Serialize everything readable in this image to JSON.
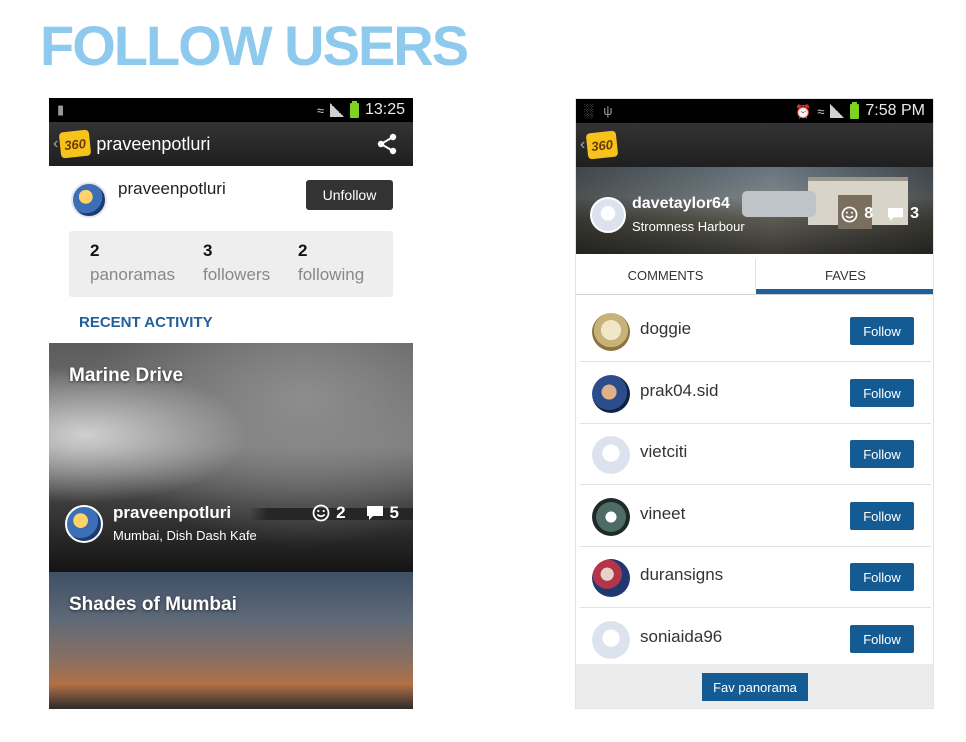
{
  "page_title": "FOLLOW USERS",
  "left_phone": {
    "status_time": "13:25",
    "logo_text": "360",
    "actionbar_title": "praveenpotluri",
    "profile": {
      "name": "praveenpotluri",
      "unfollow_label": "Unfollow"
    },
    "stats": [
      {
        "count": "2",
        "label": "panoramas"
      },
      {
        "count": "3",
        "label": "followers"
      },
      {
        "count": "2",
        "label": "following"
      }
    ],
    "recent_activity_label": "RECENT ACTIVITY",
    "panoramas": [
      {
        "title": "Marine Drive",
        "user": "praveenpotluri",
        "location": "Mumbai, Dish Dash Kafe",
        "faves": "2",
        "comments": "5"
      },
      {
        "title": "Shades of Mumbai"
      }
    ]
  },
  "right_phone": {
    "status_time": "7:58 PM",
    "logo_text": "360",
    "header": {
      "name": "davetaylor64",
      "location": "Stromness Harbour",
      "faves": "8",
      "comments": "3"
    },
    "tabs": [
      {
        "label": "COMMENTS"
      },
      {
        "label": "FAVES"
      }
    ],
    "active_tab": "FAVES",
    "faves": [
      {
        "name": "doggie",
        "follow_label": "Follow"
      },
      {
        "name": "prak04.sid",
        "follow_label": "Follow"
      },
      {
        "name": "vietciti",
        "follow_label": "Follow"
      },
      {
        "name": "vineet",
        "follow_label": "Follow"
      },
      {
        "name": "duransigns",
        "follow_label": "Follow"
      },
      {
        "name": "soniaida96",
        "follow_label": "Follow"
      }
    ],
    "fav_panorama_label": "Fav panorama"
  },
  "colors": {
    "heading": "#8ec9ee",
    "accent_blue": "#155b93",
    "recent_activity": "#1f5f9a",
    "unfollow_button": "#333333"
  },
  "icons": [
    "share-icon",
    "smiley-icon",
    "comment-icon",
    "wifi-icon",
    "signal-icon",
    "battery-icon",
    "alarm-icon",
    "usb-icon",
    "sim-icon",
    "back-chevron-icon"
  ]
}
